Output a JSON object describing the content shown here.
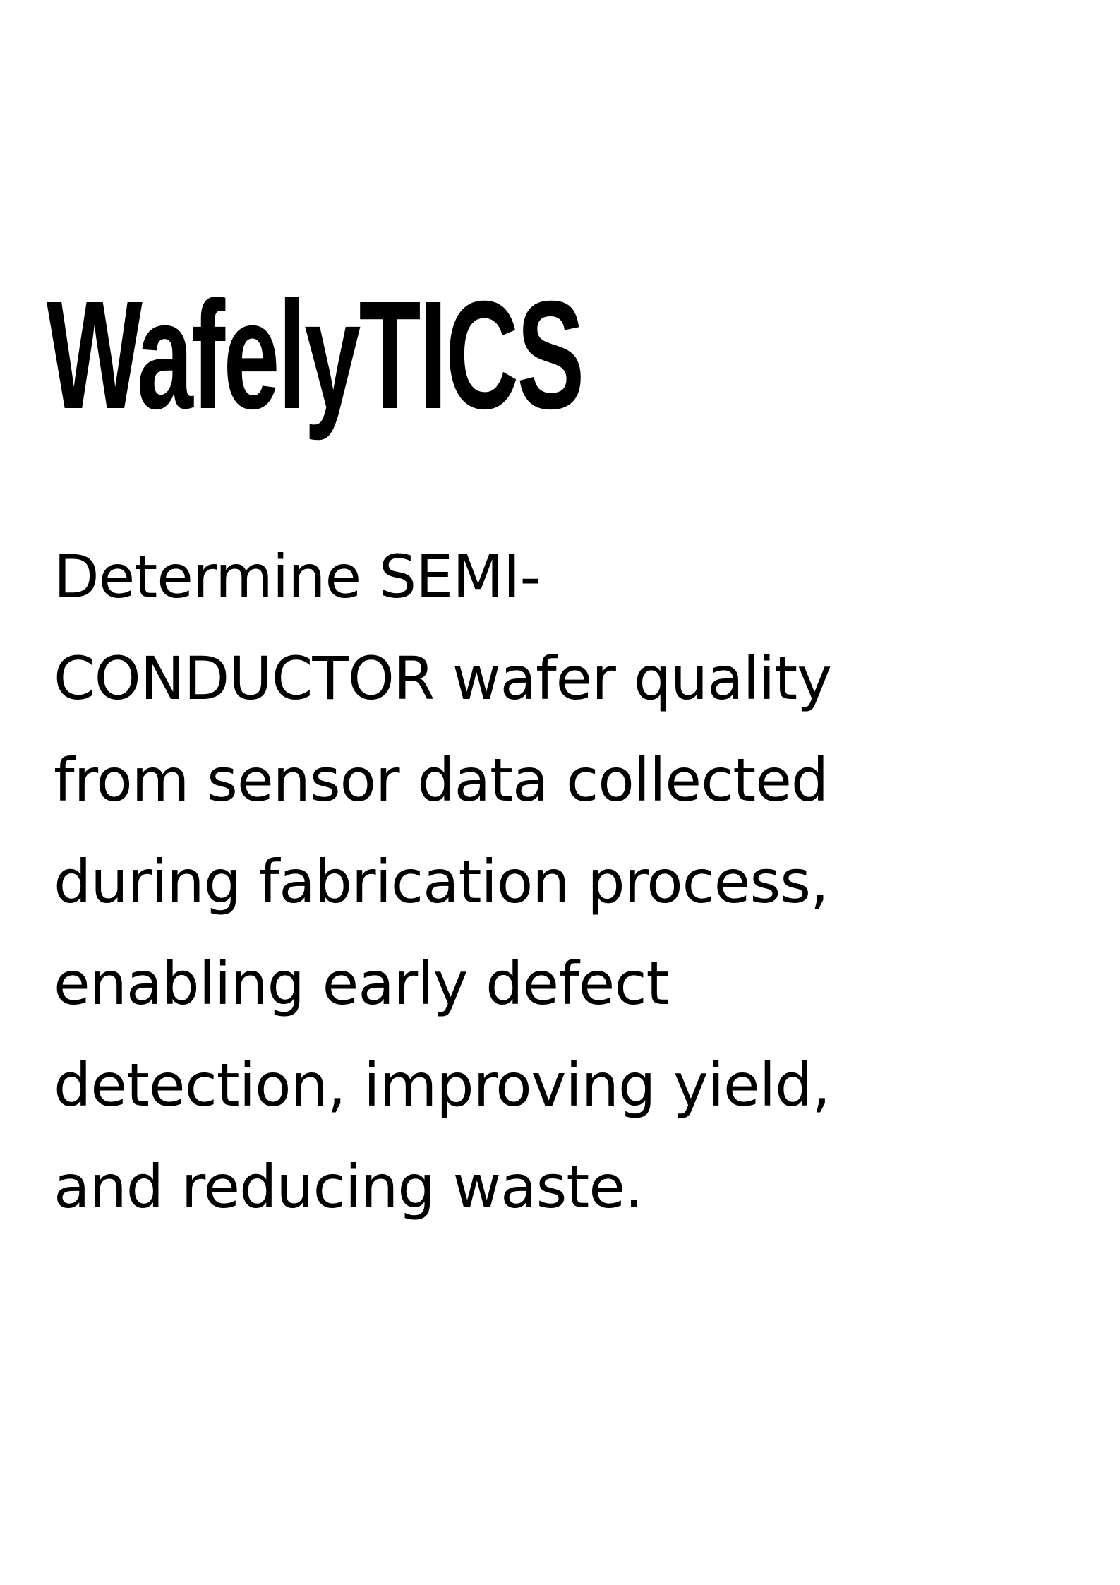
{
  "title": "WafelyTICS",
  "description_lines": [
    "Determine SEMI-",
    "CONDUCTOR wafer quality",
    "from sensor data collected",
    "during fabrication process,",
    "enabling early defect",
    "detection, improving yield,",
    "and reducing waste."
  ]
}
